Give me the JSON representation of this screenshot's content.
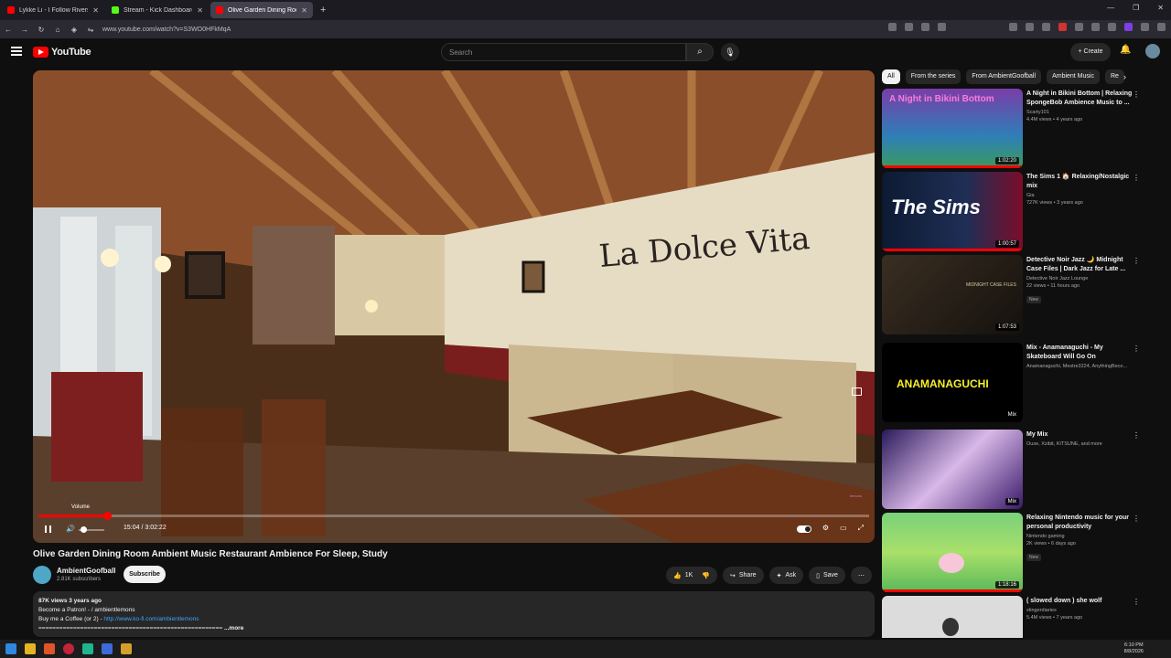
{
  "browser": {
    "tabs": [
      {
        "title": "Lykke Li - I Follow Rivers (Offici",
        "color": "#ff0000",
        "active": false
      },
      {
        "title": "Stream - Kick Dashboard",
        "color": "#53fc18",
        "active": false
      },
      {
        "title": "Olive Garden Dining Room",
        "color": "#ff0000",
        "active": true
      }
    ],
    "url": "www.youtube.com/watch?v=S3WO0HFkMqA"
  },
  "header": {
    "logo_text": "YouTube",
    "search_placeholder": "Search",
    "create_label": "Create"
  },
  "player": {
    "volume_tooltip": "Volume",
    "time": "15:04 / 3:02:22",
    "progress_fraction": 0.0825,
    "sign_text": "La Dolce Vita"
  },
  "video": {
    "title": "Olive Garden Dining Room Ambient Music Restaurant Ambience For Sleep, Study",
    "channel": "AmbientGoofball",
    "subscribers": "2.81K subscribers",
    "subscribe_label": "Subscribe",
    "likes": "1K",
    "share_label": "Share",
    "ask_label": "Ask",
    "save_label": "Save",
    "description": {
      "stats": "87K views  3 years ago",
      "line1": "Become a Patron! - ",
      "line1_handle": "/ ambientlemons",
      "line2": "Buy me a Coffee (or 2) - ",
      "line2_link": "http://www.ko-fi.com/ambientlemons",
      "line3": "=====================================================",
      "more": "...more"
    }
  },
  "sidebar": {
    "chips": [
      "All",
      "From the series",
      "From AmbientGoofball",
      "Ambient Music",
      "Re"
    ],
    "recommendations": [
      {
        "title": "A Night in Bikini Bottom | Relaxing SpongeBob Ambience Music to ...",
        "channel": "Scarty101",
        "meta": "4.4M views • 4 years ago",
        "duration": "1:02:20",
        "badge": "",
        "thumb_text": "A Night in Bikini Bottom"
      },
      {
        "title": "The Sims 1 🏠 Relaxing/Nostalgic mix",
        "channel": "Gia",
        "meta": "727K views • 3 years ago",
        "duration": "1:00:57",
        "badge": "",
        "thumb_text": "The Sims"
      },
      {
        "title": "Detective Noir Jazz 🌙 Midnight Case Files | Dark Jazz for Late ...",
        "channel": "Detective Noir Jazz Lounge",
        "meta": "22 views • 11 hours ago",
        "duration": "1:07:53",
        "badge": "New",
        "thumb_text": "MIDNIGHT CASE FILES"
      },
      {
        "title": "Mix - Anamanaguchi - My Skateboard Will Go On",
        "channel": "Anamanaguchi, Mestre3224, AnythingBeco...",
        "meta": "",
        "duration": "Mix",
        "badge": "",
        "thumb_text": "ANAMANAGUCHI"
      },
      {
        "title": "My Mix",
        "channel": "Ouse, Xzibit, KITSUNE, and more",
        "meta": "",
        "duration": "Mix",
        "badge": "",
        "thumb_text": ""
      },
      {
        "title": "Relaxing Nintendo music for your personal productivity",
        "channel": "Nintendo gaming",
        "meta": "2K views • 6 days ago",
        "duration": "1:18:16",
        "badge": "New",
        "thumb_text": ""
      },
      {
        "title": "( slowed down ) she wolf",
        "channel": "stingerdiaries",
        "meta": "5.4M views • 7 years ago",
        "duration": "",
        "badge": "",
        "thumb_text": ""
      }
    ]
  },
  "taskbar": {
    "time": "6:10 PM",
    "date": "8/8/2026"
  }
}
